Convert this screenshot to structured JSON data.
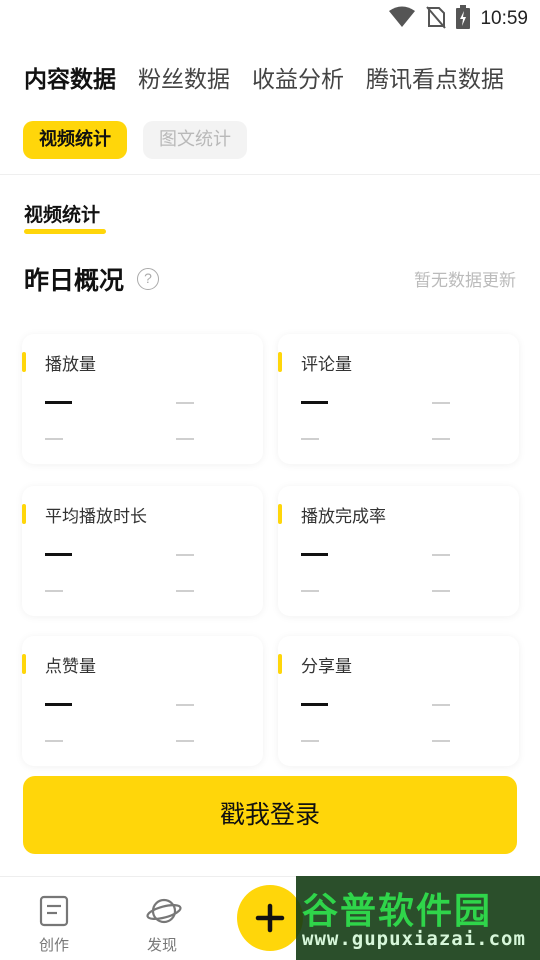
{
  "status_bar": {
    "time": "10:59",
    "icons": [
      "wifi-icon",
      "no-sim-icon",
      "battery-charging-icon"
    ]
  },
  "top_tabs": [
    {
      "label": "内容数据",
      "active": true
    },
    {
      "label": "粉丝数据",
      "active": false
    },
    {
      "label": "收益分析",
      "active": false
    },
    {
      "label": "腾讯看点数据",
      "active": false
    }
  ],
  "sub_tabs": [
    {
      "label": "视频统计",
      "active": true
    },
    {
      "label": "图文统计",
      "active": false
    }
  ],
  "section": {
    "tab_label": "视频统计",
    "overview_title": "昨日概况",
    "help_symbol": "?",
    "update_status": "暂无数据更新"
  },
  "cards": [
    {
      "label": "播放量"
    },
    {
      "label": "评论量"
    },
    {
      "label": "平均播放时长"
    },
    {
      "label": "播放完成率"
    },
    {
      "label": "点赞量"
    },
    {
      "label": "分享量"
    }
  ],
  "login_button": {
    "label": "戳我登录"
  },
  "bottom_nav": [
    {
      "label": "创作",
      "icon": "document-icon"
    },
    {
      "label": "发现",
      "icon": "planet-icon"
    }
  ],
  "plus_button": {
    "icon": "plus-icon"
  },
  "watermark": {
    "text": "谷普软件园",
    "url": "www.gupuxiazai.com"
  },
  "colors": {
    "accent": "#ffd60a",
    "text_primary": "#111111",
    "text_muted": "#bbbbbb"
  }
}
